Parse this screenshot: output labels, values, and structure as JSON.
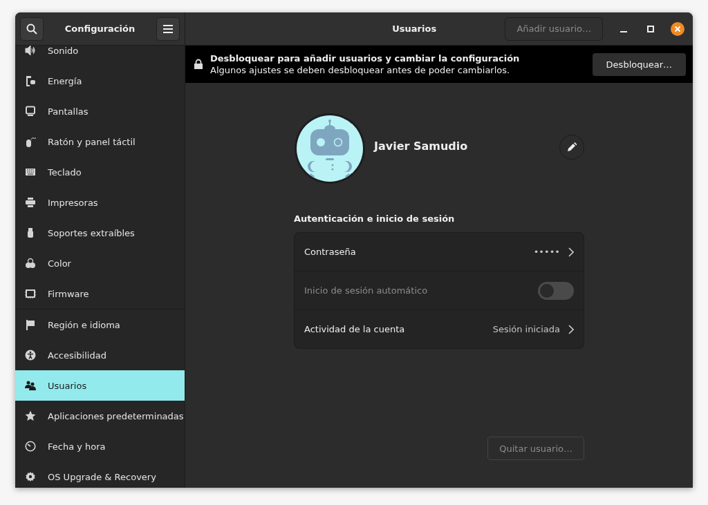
{
  "sidebar": {
    "title": "Configuración",
    "sections": [
      [
        {
          "label": "Sonido",
          "selected": false
        },
        {
          "label": "Energía",
          "selected": false
        },
        {
          "label": "Pantallas",
          "selected": false
        },
        {
          "label": "Ratón y panel táctil",
          "selected": false
        },
        {
          "label": "Teclado",
          "selected": false
        },
        {
          "label": "Impresoras",
          "selected": false
        },
        {
          "label": "Soportes extraíbles",
          "selected": false
        },
        {
          "label": "Color",
          "selected": false
        },
        {
          "label": "Firmware",
          "selected": false
        }
      ],
      [
        {
          "label": "Región e idioma",
          "selected": false
        },
        {
          "label": "Accesibilidad",
          "selected": false
        },
        {
          "label": "Usuarios",
          "selected": true
        },
        {
          "label": "Aplicaciones predeterminadas",
          "selected": false
        },
        {
          "label": "Fecha y hora",
          "selected": false
        },
        {
          "label": "OS Upgrade & Recovery",
          "selected": false
        }
      ]
    ]
  },
  "header": {
    "title": "Usuarios",
    "add_button": "Añadir usuario…",
    "add_disabled": true
  },
  "infobar": {
    "title": "Desbloquear para añadir usuarios y cambiar la configuración",
    "message": "Algunos ajustes se deben desbloquear antes de poder cambiarlos.",
    "button": "Desbloquear…"
  },
  "user": {
    "name": "Javier Samudio"
  },
  "auth": {
    "heading": "Autenticación e inicio de sesión",
    "rows": [
      {
        "kind": "link",
        "label": "Contraseña",
        "value": "•••••",
        "disabled": false
      },
      {
        "kind": "switch",
        "label": "Inicio de sesión automático",
        "on": false,
        "disabled": true
      },
      {
        "kind": "link",
        "label": "Actividad de la cuenta",
        "value": "Sesión iniciada",
        "disabled": false
      }
    ]
  },
  "remove_button": {
    "label": "Quitar usuario…",
    "disabled": true
  }
}
